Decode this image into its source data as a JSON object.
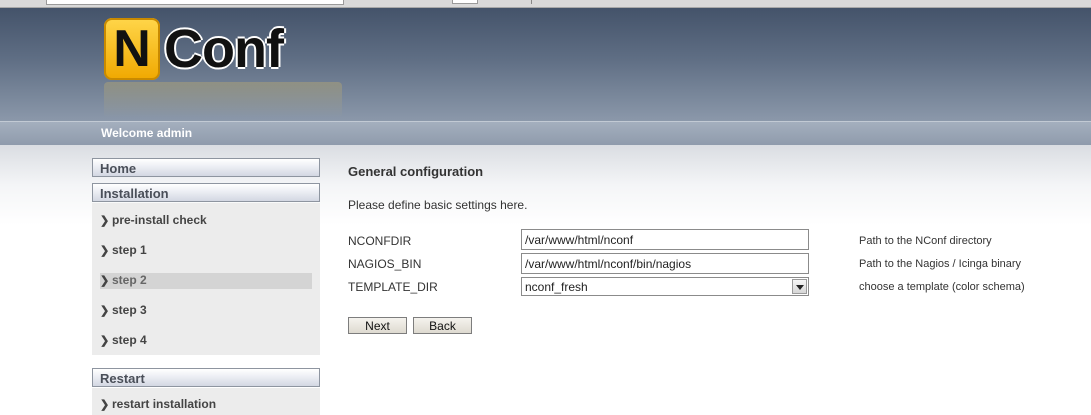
{
  "brand": {
    "logo_letter": "N",
    "logo_word": "Conf"
  },
  "header": {
    "welcome": "Welcome admin"
  },
  "nav": {
    "home": "Home",
    "installation": "Installation",
    "install_items": [
      {
        "label": "pre-install check"
      },
      {
        "label": "step 1"
      },
      {
        "label": "step 2",
        "active": true
      },
      {
        "label": "step 3"
      },
      {
        "label": "step 4"
      }
    ],
    "restart": "Restart",
    "restart_items": [
      {
        "label": "restart installation"
      }
    ]
  },
  "main": {
    "title": "General configuration",
    "intro": "Please define basic settings here.",
    "fields": [
      {
        "name": "NCONFDIR",
        "value": "/var/www/html/nconf",
        "help": "Path to the NConf directory"
      },
      {
        "name": "NAGIOS_BIN",
        "value": "/var/www/html/nconf/bin/nagios",
        "help": "Path to the Nagios / Icinga binary"
      },
      {
        "name": "TEMPLATE_DIR",
        "value": "nconf_fresh",
        "help": "choose a template (color schema)"
      }
    ],
    "next_label": "Next",
    "back_label": "Back"
  },
  "icons": {
    "nav_arrow": "chevron-right-icon",
    "dropdown": "chevron-down-icon"
  },
  "colors": {
    "header_top": "#44536a",
    "welcome_bar": "#96a2b2",
    "logo_yellow": "#f7c21a"
  }
}
